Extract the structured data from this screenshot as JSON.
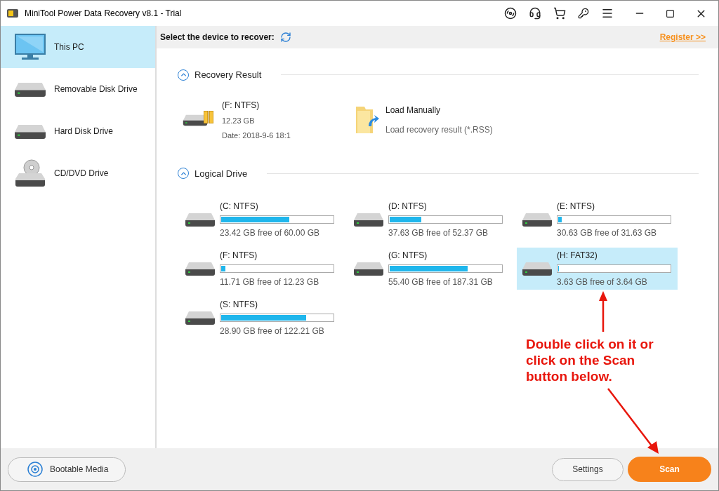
{
  "window": {
    "title": "MiniTool Power Data Recovery v8.1 - Trial"
  },
  "sidebar": {
    "items": [
      {
        "label": "This PC",
        "kind": "pc",
        "selected": true
      },
      {
        "label": "Removable Disk Drive",
        "kind": "removable",
        "selected": false
      },
      {
        "label": "Hard Disk Drive",
        "kind": "hdd",
        "selected": false
      },
      {
        "label": "CD/DVD Drive",
        "kind": "cd",
        "selected": false
      }
    ]
  },
  "header": {
    "prompt": "Select the device to recover:",
    "register_link": "Register >>"
  },
  "recovery_result": {
    "title": "Recovery Result",
    "expanded": true,
    "item": {
      "name": "(F: NTFS)",
      "size": "12.23 GB",
      "date": "Date: 2018-9-6 18:1"
    },
    "load": {
      "title": "Load Manually",
      "subtitle": "Load recovery result (*.RSS)"
    }
  },
  "logical_drive": {
    "title": "Logical Drive",
    "expanded": true,
    "drives": [
      {
        "name": "(C: NTFS)",
        "level": 0.61,
        "free": "23.42 GB free of 60.00 GB",
        "selected": false
      },
      {
        "name": "(D: NTFS)",
        "level": 0.28,
        "free": "37.63 GB free of 52.37 GB",
        "selected": false
      },
      {
        "name": "(E: NTFS)",
        "level": 0.03,
        "free": "30.63 GB free of 31.63 GB",
        "selected": false
      },
      {
        "name": "(F: NTFS)",
        "level": 0.04,
        "free": "11.71 GB free of 12.23 GB",
        "selected": false
      },
      {
        "name": "(G: NTFS)",
        "level": 0.7,
        "free": "55.40 GB free of 187.31 GB",
        "selected": false
      },
      {
        "name": "(H: FAT32)",
        "level": 0.003,
        "free": "3.63 GB free of 3.64 GB",
        "selected": true
      },
      {
        "name": "(S: NTFS)",
        "level": 0.76,
        "free": "28.90 GB free of 122.21 GB",
        "selected": false
      }
    ]
  },
  "annotation": {
    "lines": [
      "Double click on it or",
      "click on the Scan",
      "button below."
    ]
  },
  "footer": {
    "bootable": "Bootable Media",
    "settings": "Settings",
    "scan": "Scan"
  }
}
